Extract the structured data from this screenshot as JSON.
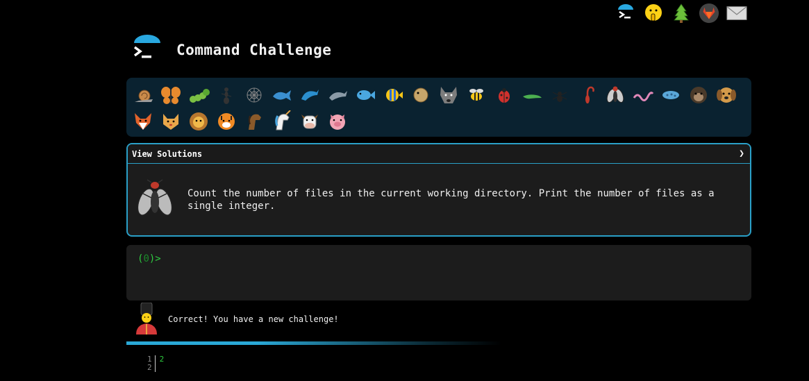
{
  "app": {
    "title": "Command Challenge"
  },
  "topnav": {
    "items": [
      "terminal-logo",
      "shushing-face",
      "evergreen-tree",
      "gitlab",
      "envelope"
    ]
  },
  "animals": [
    "snail",
    "butterfly",
    "caterpillar",
    "ant",
    "spider-web",
    "whale",
    "dolphin-blue",
    "dolphin-gray",
    "fish",
    "tropical-fish",
    "blowfish",
    "wolf",
    "bee",
    "ladybug",
    "lizard",
    "spider",
    "scorpion",
    "fly",
    "worm",
    "microbe",
    "gorilla",
    "dog",
    "fox",
    "cat",
    "lion",
    "tiger",
    "horse",
    "unicorn",
    "cow",
    "pig"
  ],
  "challenge": {
    "toggle_label": "View Solutions",
    "chevron": "❯",
    "icon": "fly",
    "text": "Count the number of files in the current working directory. Print the number of files as a single integer."
  },
  "terminal": {
    "prompt_open": "(",
    "prompt_num": "0",
    "prompt_close": ")>"
  },
  "feedback": {
    "icon": "guard",
    "text": "Correct! You have a new challenge!"
  },
  "progress": {
    "fraction": 0.6
  },
  "output": {
    "line_numbers": [
      "1",
      "2"
    ],
    "lines": [
      "2",
      ""
    ]
  },
  "colors": {
    "accent": "#2aa0c8",
    "prompt": "#2ecc40",
    "bar_bg": "#0a2230"
  }
}
